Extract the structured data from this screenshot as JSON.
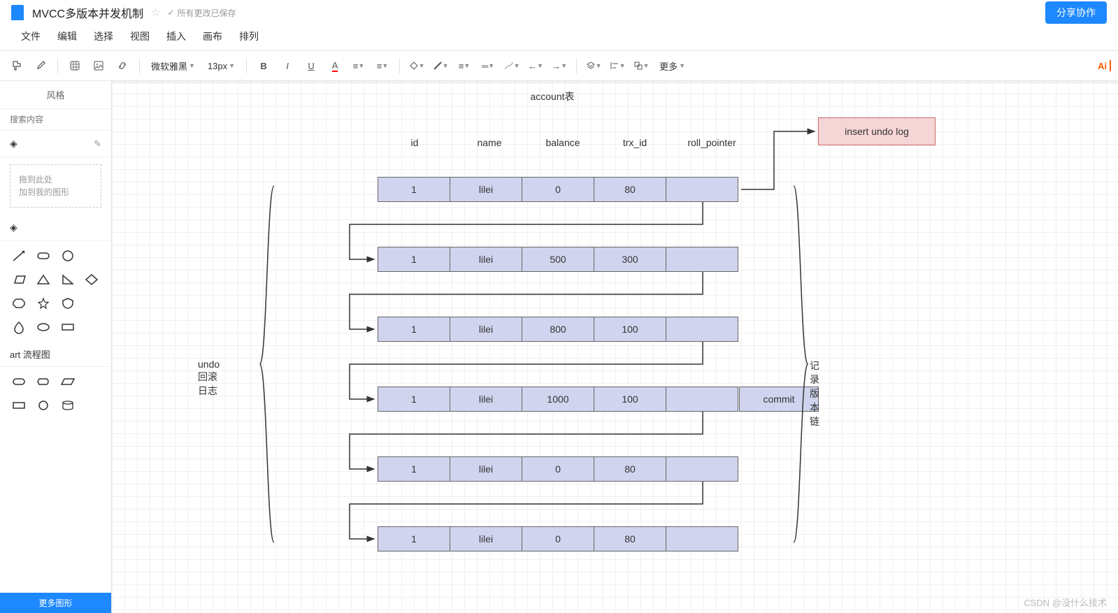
{
  "header": {
    "title": "MVCC多版本并发机制",
    "saved_status": "所有更改已保存",
    "share_label": "分享协作"
  },
  "menu": {
    "file": "文件",
    "edit": "编辑",
    "select": "选择",
    "view": "视图",
    "insert": "插入",
    "canvas": "画布",
    "arrange": "排列"
  },
  "toolbar": {
    "font": "微软雅黑",
    "size": "13px",
    "more": "更多",
    "ai": "Ai"
  },
  "sidebar": {
    "style_tab": "风格",
    "search_placeholder": "搜索内容",
    "dropzone_line1": "拖到此处",
    "dropzone_line2": "加到我的图形",
    "section2": "art 流程图",
    "more_shapes": "更多图形"
  },
  "diagram": {
    "table_title": "account表",
    "headers": [
      "id",
      "name",
      "balance",
      "trx_id",
      "roll_pointer"
    ],
    "rows": [
      {
        "id": "1",
        "name": "lilei",
        "balance": "0",
        "trx_id": "80"
      },
      {
        "id": "1",
        "name": "lilei",
        "balance": "500",
        "trx_id": "300"
      },
      {
        "id": "1",
        "name": "lilei",
        "balance": "800",
        "trx_id": "100"
      },
      {
        "id": "1",
        "name": "lilei",
        "balance": "1000",
        "trx_id": "100"
      },
      {
        "id": "1",
        "name": "lilei",
        "balance": "0",
        "trx_id": "80"
      },
      {
        "id": "1",
        "name": "lilei",
        "balance": "0",
        "trx_id": "80"
      }
    ],
    "insert_undo": "insert undo log",
    "commit": "commit",
    "left_label": "undo 回滚日志",
    "right_label": "记录版本链"
  },
  "watermark": "CSDN @没什么技术"
}
